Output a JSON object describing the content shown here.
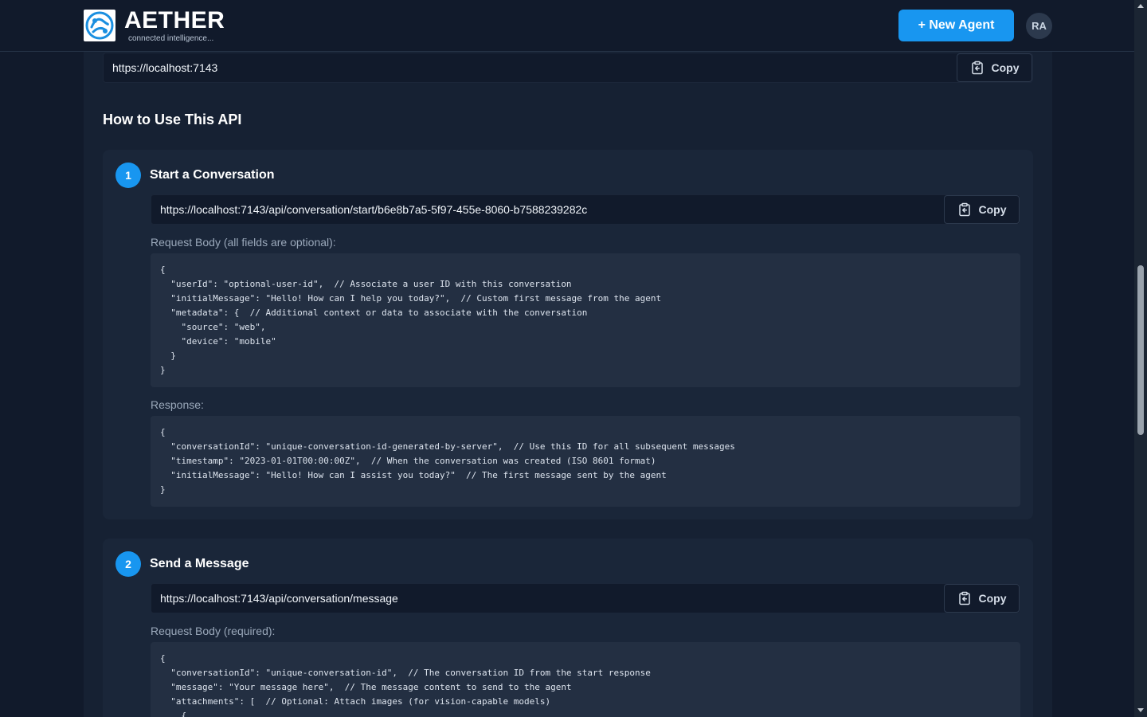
{
  "header": {
    "brand_name": "AETHER",
    "brand_tagline": "connected intelligence...",
    "new_agent_label": "+ New Agent",
    "avatar_initials": "RA"
  },
  "base_url": {
    "url": "https://localhost:7143",
    "copy_label": "Copy"
  },
  "section": {
    "title": "How to Use This API"
  },
  "steps": [
    {
      "number": "1",
      "title": "Start a Conversation",
      "url": "https://localhost:7143/api/conversation/start/b6e8b7a5-5f97-455e-8060-b7588239282c",
      "copy_label": "Copy",
      "request_label": "Request Body (all fields are optional):",
      "request_body": "{\n  \"userId\": \"optional-user-id\",  // Associate a user ID with this conversation\n  \"initialMessage\": \"Hello! How can I help you today?\",  // Custom first message from the agent\n  \"metadata\": {  // Additional context or data to associate with the conversation\n    \"source\": \"web\",\n    \"device\": \"mobile\"\n  }\n}",
      "response_label": "Response:",
      "response_body": "{\n  \"conversationId\": \"unique-conversation-id-generated-by-server\",  // Use this ID for all subsequent messages\n  \"timestamp\": \"2023-01-01T00:00:00Z\",  // When the conversation was created (ISO 8601 format)\n  \"initialMessage\": \"Hello! How can I assist you today?\"  // The first message sent by the agent\n}"
    },
    {
      "number": "2",
      "title": "Send a Message",
      "url": "https://localhost:7143/api/conversation/message",
      "copy_label": "Copy",
      "request_label": "Request Body (required):",
      "request_body": "{\n  \"conversationId\": \"unique-conversation-id\",  // The conversation ID from the start response\n  \"message\": \"Your message here\",  // The message content to send to the agent\n  \"attachments\": [  // Optional: Attach images (for vision-capable models)\n    {"
    }
  ],
  "colors": {
    "accent": "#1896f0",
    "background": "#111a2b",
    "panel": "#162133",
    "card": "#1a2639",
    "code": "#232f42"
  }
}
